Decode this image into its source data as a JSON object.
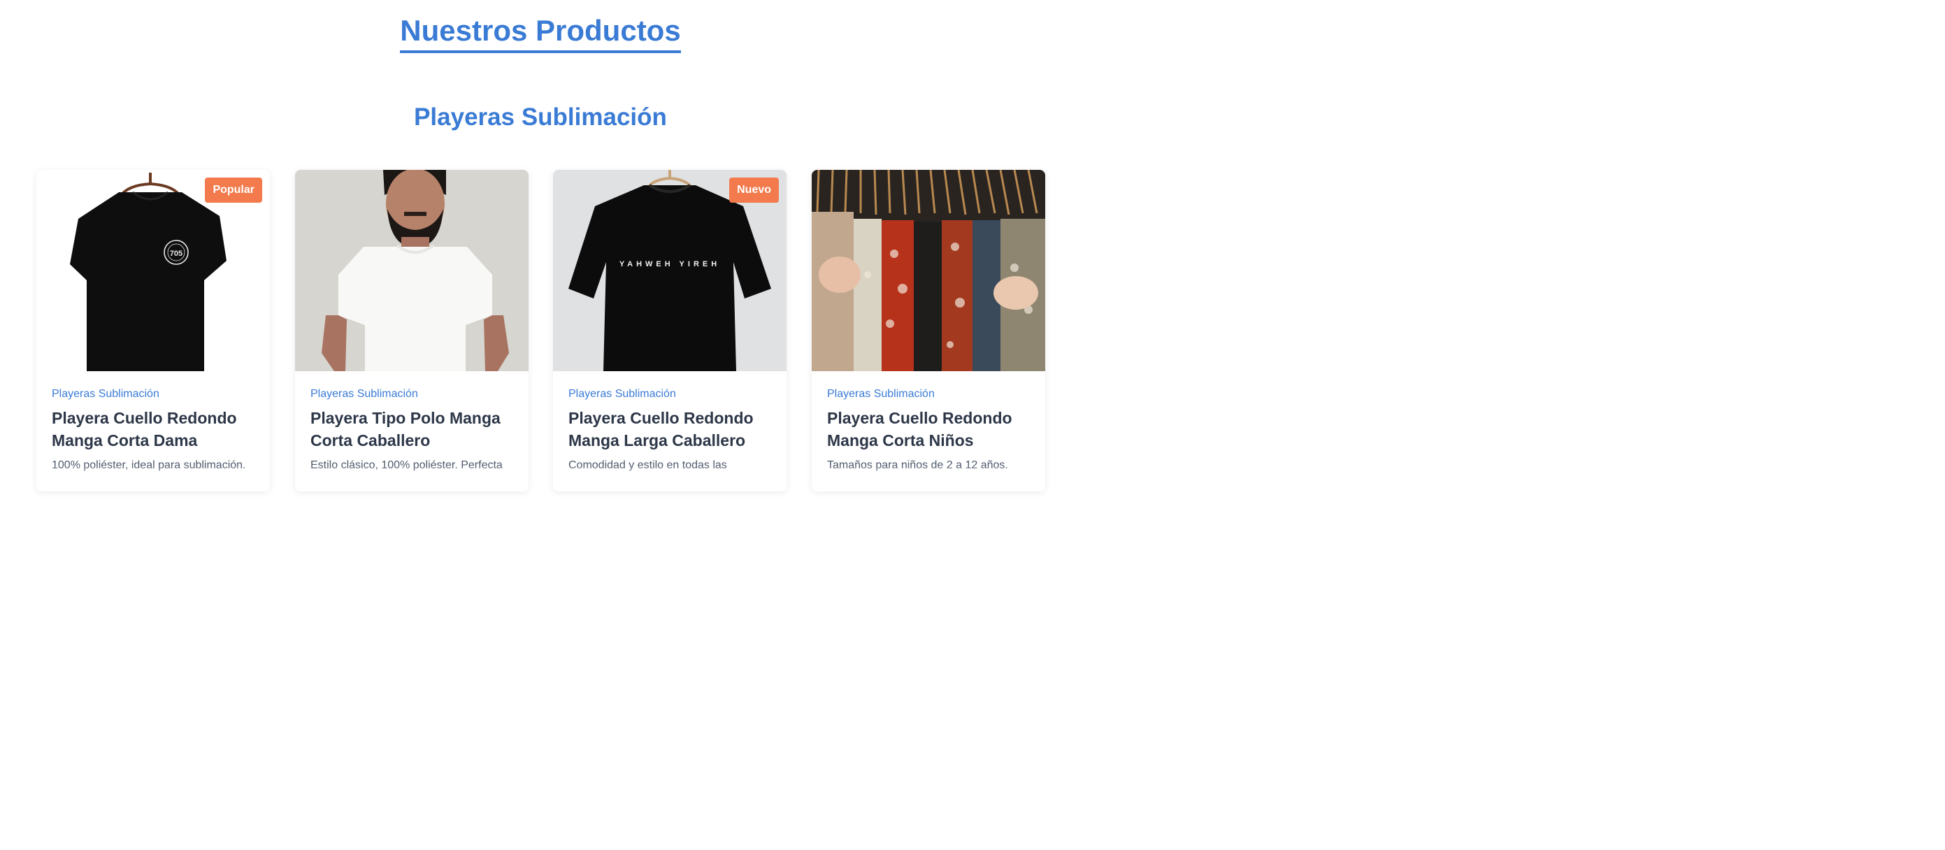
{
  "page_title": "Nuestros Productos",
  "section_title": "Playeras Sublimación",
  "products": [
    {
      "badge": "Popular",
      "category": "Playeras Sublimación",
      "name": "Playera Cuello Redondo Manga Corta Dama",
      "description": "100% poliéster, ideal para sublimación.",
      "image": "black-tshirt-on-hanger-with-logo"
    },
    {
      "badge": "",
      "category": "Playeras Sublimación",
      "name": "Playera Tipo Polo Manga Corta Caballero",
      "description": "Estilo clásico, 100% poliéster. Perfecta",
      "image": "man-in-white-tshirt"
    },
    {
      "badge": "Nuevo",
      "category": "Playeras Sublimación",
      "name": "Playera Cuello Redondo Manga Larga Caballero",
      "description": "Comodidad y estilo en todas las",
      "image": "black-tshirt-on-hanger-with-text"
    },
    {
      "badge": "",
      "category": "Playeras Sublimación",
      "name": "Playera Cuello Redondo Manga Corta Niños",
      "description": "Tamaños para niños de 2 a 12 años.",
      "image": "clothes-rack"
    }
  ],
  "tshirt_logo_text": "705",
  "tshirt_print_text": "YAHWEH YIREH",
  "colors": {
    "accent": "#3a7bd5",
    "badge": "#f27a4c"
  }
}
